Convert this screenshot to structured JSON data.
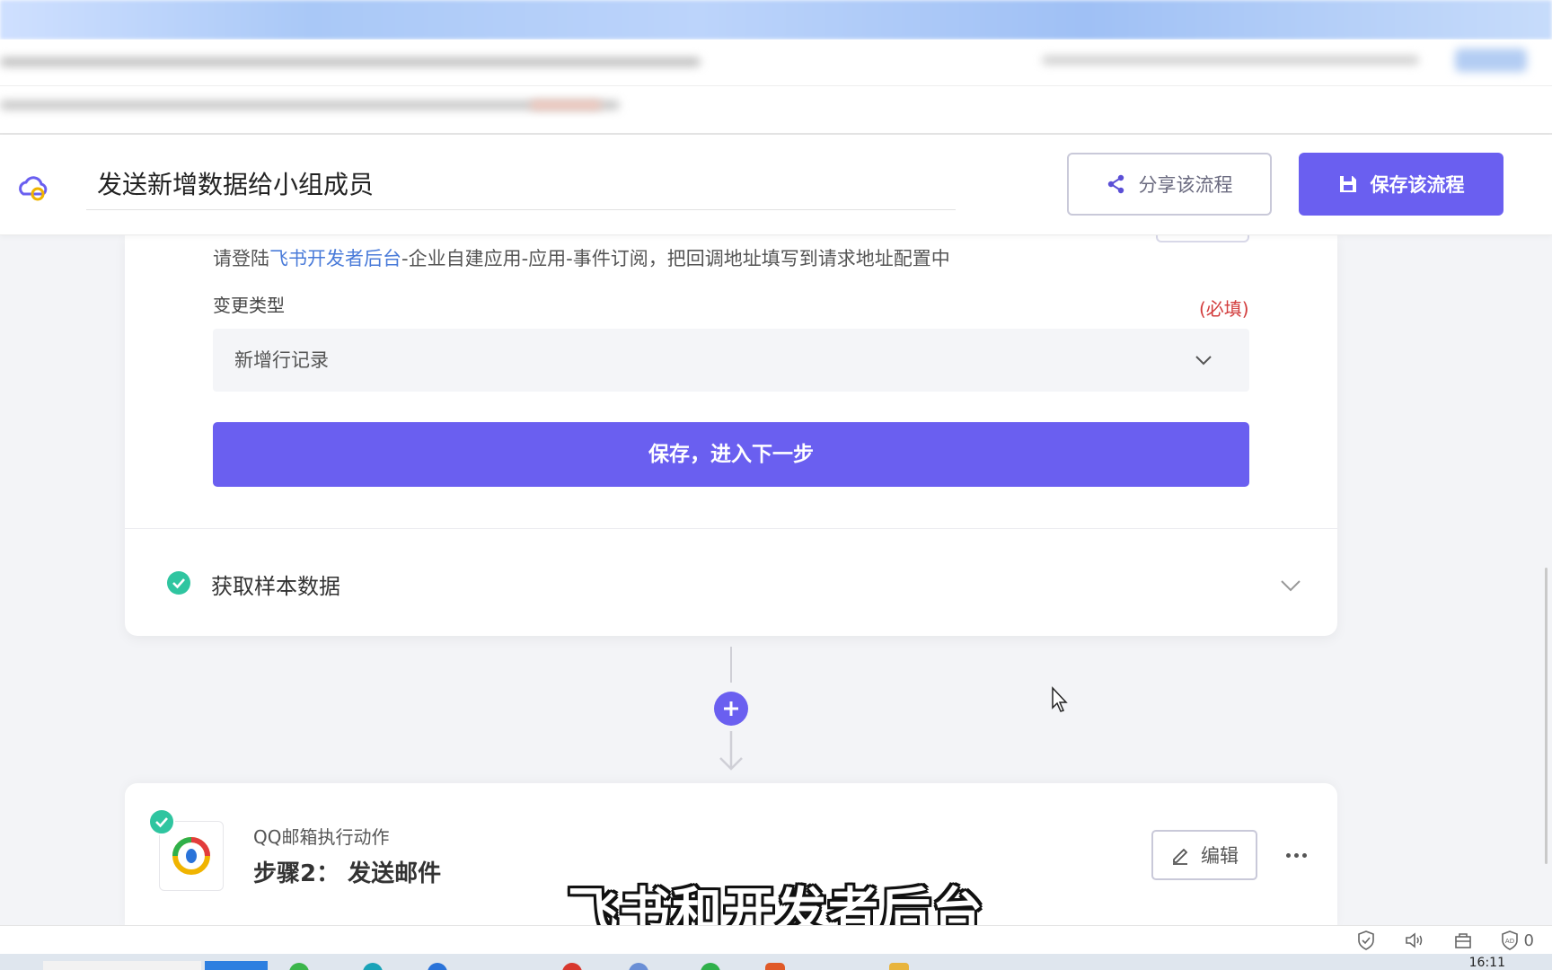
{
  "header": {
    "flow_title": "发送新增数据给小组成员",
    "share_label": "分享该流程",
    "save_label": "保存该流程"
  },
  "trigger_card": {
    "hint_prefix": "请登陆",
    "hint_link": "飞书开发者后台",
    "hint_suffix": "-企业自建应用-应用-事件订阅，把回调地址填写到请求地址配置中",
    "change_type_label": "变更类型",
    "required_label": "(必填)",
    "change_type_value": "新增行记录",
    "next_button_label": "保存，进入下一步",
    "sample_section_label": "获取样本数据"
  },
  "action_card": {
    "app_subtitle": "QQ邮箱执行动作",
    "step_title": "步骤2： 发送邮件",
    "edit_label": "编辑"
  },
  "subtitle_caption": "飞书和开发者后台",
  "status_bar": {
    "notification_count": "0"
  },
  "taskbar": {
    "clock": "16:11"
  },
  "colors": {
    "accent": "#6a5ff0",
    "success": "#2fc5a0",
    "required": "#d23c3c",
    "link": "#4a7bd9"
  },
  "icons": {
    "logo": "cloud-logo-icon",
    "share": "share-icon",
    "save": "floppy-disk-icon",
    "select": "chevron-down-icon",
    "done": "check-circle-icon",
    "add": "plus-circle-icon",
    "edit": "pencil-icon",
    "more": "more-horizontal-icon"
  }
}
